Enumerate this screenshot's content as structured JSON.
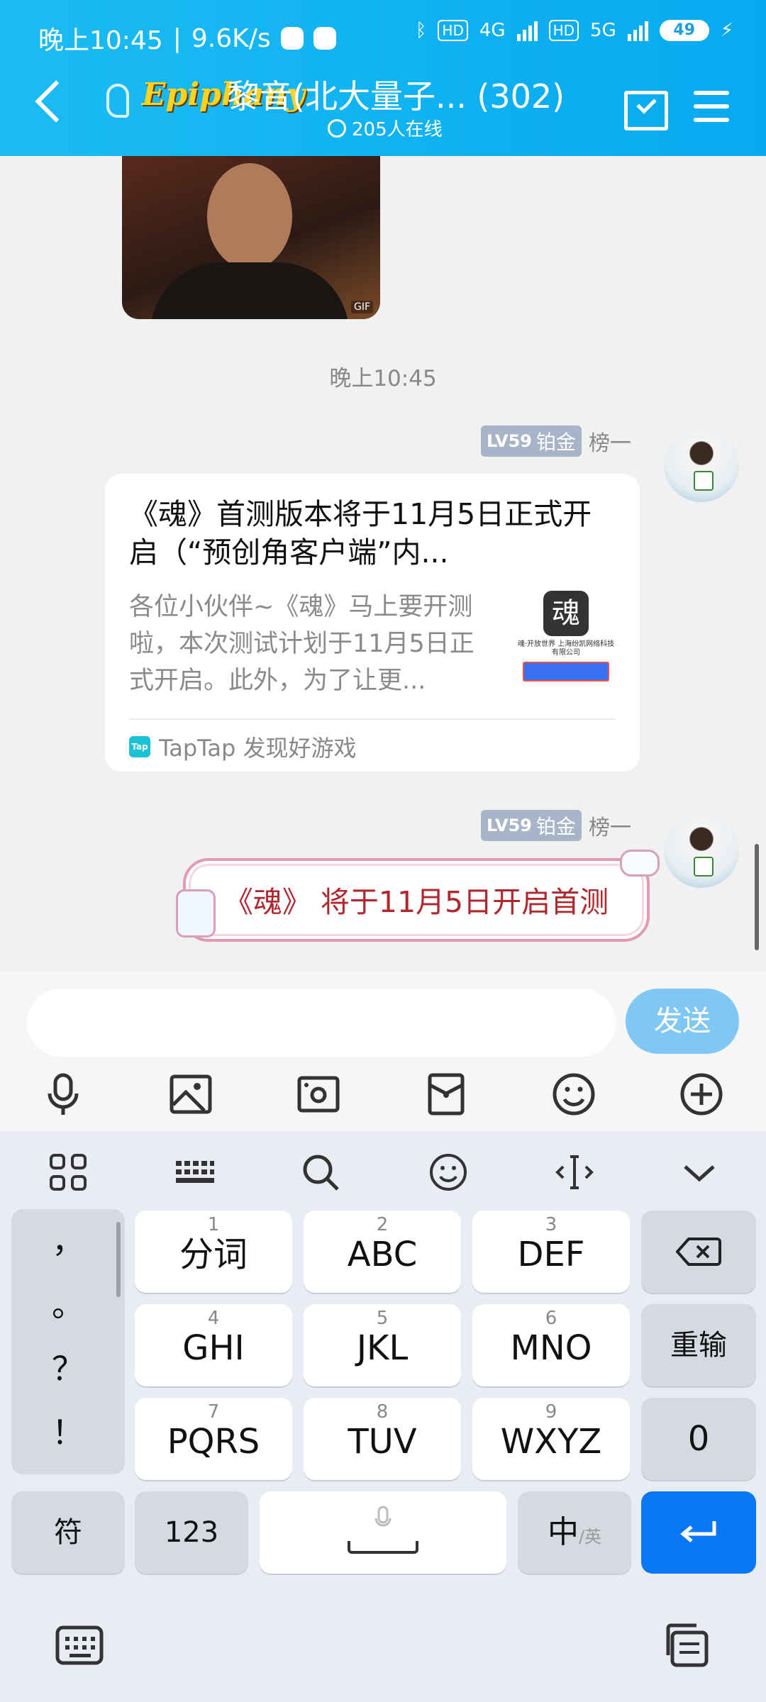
{
  "status_bar": {
    "time": "晚上10:45",
    "network_speed": "9.6K/s",
    "hd1": "HD",
    "net1": "4G",
    "hd2": "HD",
    "net2": "5G",
    "battery": "49"
  },
  "header": {
    "logo_text": "Epiphany",
    "title": "黎音(北大量子... (302)",
    "online": "205人在线"
  },
  "chat": {
    "gif_badge": "GIF",
    "timestamp": "晚上10:45",
    "messages": [
      {
        "level": "LV59",
        "tier": "铂金",
        "nickname": "榜一",
        "card_title": "《魂》首测版本将于11月5日正式开启（“预创角客户端”内...",
        "card_desc": "各位小伙伴~《魂》马上要开测啦，本次测试计划于11月5日正式开启。此外，为了让更...",
        "thumb_logo": "魂",
        "thumb_text": "魂·开放世界 上海纷凯网络科技有限公司",
        "card_source": "TapTap 发现好游戏",
        "source_icon": "Tap"
      },
      {
        "level": "LV59",
        "tier": "铂金",
        "nickname": "榜一",
        "text": "《魂》 将于11月5日开启首测"
      }
    ]
  },
  "composer": {
    "input_value": "",
    "send_label": "发送",
    "tools": [
      "mic-icon",
      "image-icon",
      "camera-icon",
      "box-icon",
      "emoji-icon",
      "plus-icon"
    ]
  },
  "keyboard": {
    "punctuation": [
      "，",
      "。",
      "？",
      "！"
    ],
    "rows": [
      [
        {
          "num": "1",
          "label": "分词"
        },
        {
          "num": "2",
          "label": "ABC"
        },
        {
          "num": "3",
          "label": "DEF"
        }
      ],
      [
        {
          "num": "4",
          "label": "GHI"
        },
        {
          "num": "5",
          "label": "JKL"
        },
        {
          "num": "6",
          "label": "MNO"
        }
      ],
      [
        {
          "num": "7",
          "label": "PQRS"
        },
        {
          "num": "8",
          "label": "TUV"
        },
        {
          "num": "9",
          "label": "WXYZ"
        }
      ]
    ],
    "reinput": "重输",
    "zero": "0",
    "symbols": "符",
    "numeric": "123",
    "lang_main": "中",
    "lang_sub": "/英"
  },
  "colors": {
    "header": "#08a9f0",
    "send": "#80c7f5",
    "enter": "#0a77f5",
    "bubble_text": "#b0282e"
  }
}
